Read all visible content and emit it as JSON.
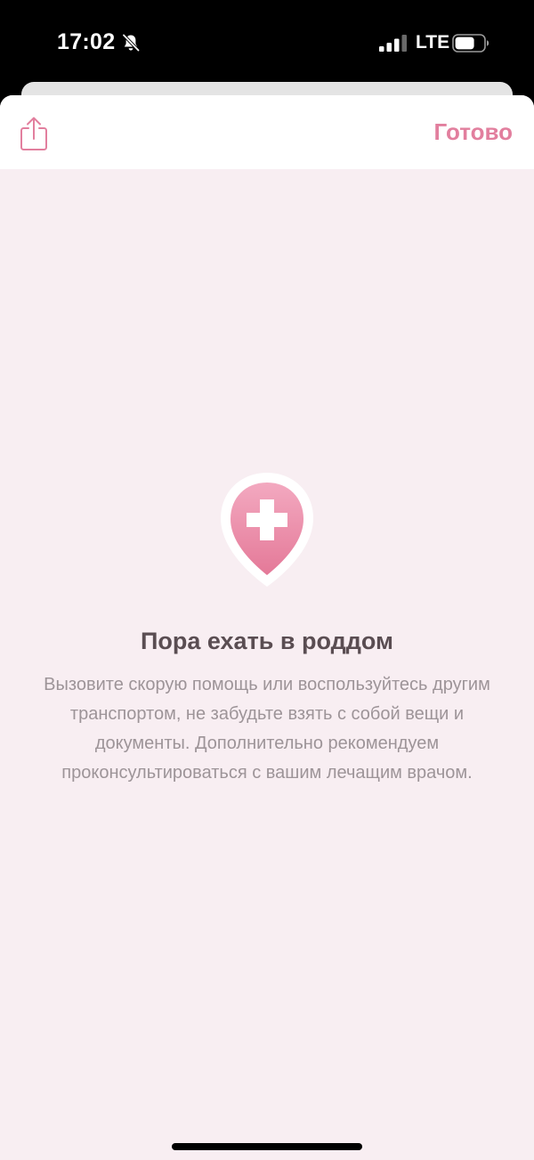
{
  "status_bar": {
    "time": "17:02",
    "network": "LTE",
    "icons": [
      "bell-slash-icon",
      "signal-icon",
      "battery-icon"
    ]
  },
  "nav": {
    "share_icon": "share-icon",
    "done_label": "Готово"
  },
  "content": {
    "icon": "hospital-pin-icon",
    "title": "Пора ехать в роддом",
    "body": "Вызовите скорую помощь или воспользуйтесь другим транспортом, не забудьте взять с собой вещи и документы. Дополнительно рекомендуем проконсультироваться с вашим лечащим врачом."
  },
  "colors": {
    "accent": "#e27f9e",
    "sheet_background": "#f8eef2",
    "nav_background": "#ffffff",
    "title_text": "#5a4d52",
    "body_text": "#9d9498"
  }
}
